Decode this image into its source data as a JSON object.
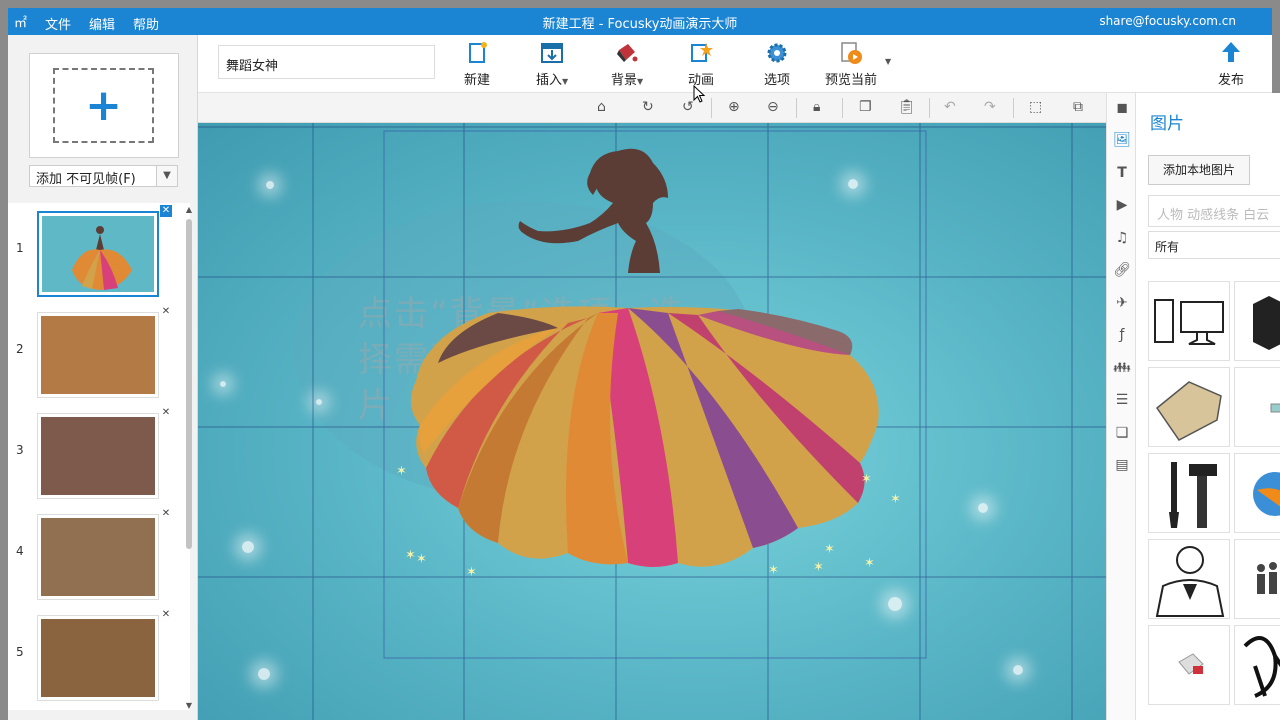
{
  "titlebar": {
    "app_icon": "㎡",
    "menu": [
      "文件",
      "编辑",
      "帮助"
    ],
    "title": "新建工程 - Focusky动画演示大师",
    "account": "share@focusky.com.cn"
  },
  "left": {
    "add_select": "添加 不可见帧(F)",
    "frames": [
      {
        "num": "1",
        "color": "#5fb8c6",
        "active": true
      },
      {
        "num": "2",
        "color": "#b37a45"
      },
      {
        "num": "3",
        "color": "#7e5a4c"
      },
      {
        "num": "4",
        "color": "#907050"
      },
      {
        "num": "5",
        "color": "#8a633f"
      }
    ]
  },
  "toolbar": {
    "project_name": "舞蹈女神",
    "buttons": [
      {
        "label": "新建",
        "icon": "new-icon"
      },
      {
        "label": "插入",
        "icon": "insert-icon",
        "caret": true
      },
      {
        "label": "背景",
        "icon": "background-icon",
        "caret": true
      },
      {
        "label": "动画",
        "icon": "animation-icon"
      },
      {
        "label": "选项",
        "icon": "options-icon"
      },
      {
        "label": "预览当前",
        "icon": "preview-icon",
        "caret": true
      },
      {
        "label": "发布",
        "icon": "publish-icon"
      }
    ]
  },
  "canvas": {
    "placeholder_text": "点击“背景”选项，选择需要更换的背景图片"
  },
  "rpanel": {
    "title": "图片",
    "add_local": "添加本地图片",
    "search_placeholder": "人物 动感线条 白云",
    "filter": "所有"
  },
  "colors": {
    "accent": "#1b85d3",
    "canvas_bg": "#56b3c4"
  }
}
